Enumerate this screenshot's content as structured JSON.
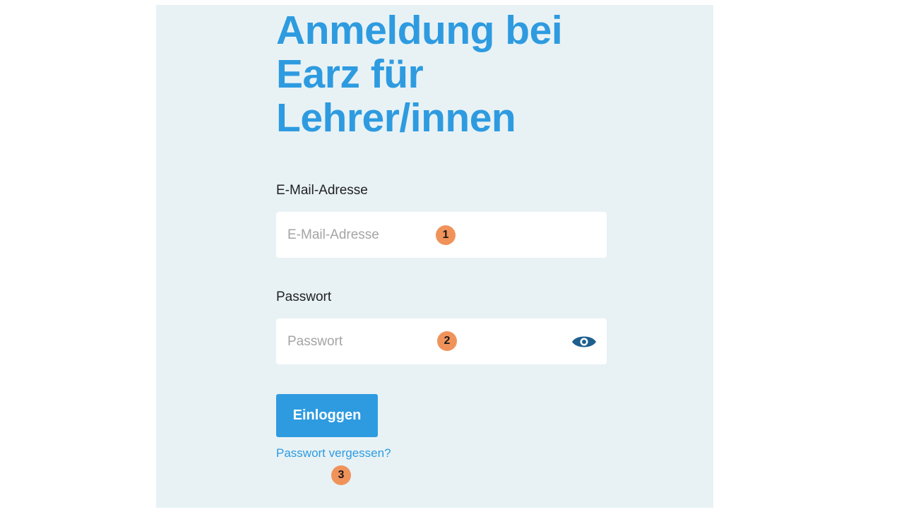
{
  "login": {
    "title": "Anmeldung bei Earz für Lehrer/innen",
    "email": {
      "label": "E-Mail-Adresse",
      "placeholder": "E-Mail-Adresse",
      "value": ""
    },
    "password": {
      "label": "Passwort",
      "placeholder": "Passwort",
      "value": "",
      "toggle_icon": "eye-icon"
    },
    "submit_label": "Einloggen",
    "forgot_link": "Passwort vergessen?"
  },
  "annotations": {
    "badge_1": "1",
    "badge_2": "2",
    "badge_3": "3"
  },
  "colors": {
    "accent": "#2e9be0",
    "panel_background": "#e8f2f5",
    "badge": "#f0935a",
    "eye_icon": "#1e5f8e"
  }
}
